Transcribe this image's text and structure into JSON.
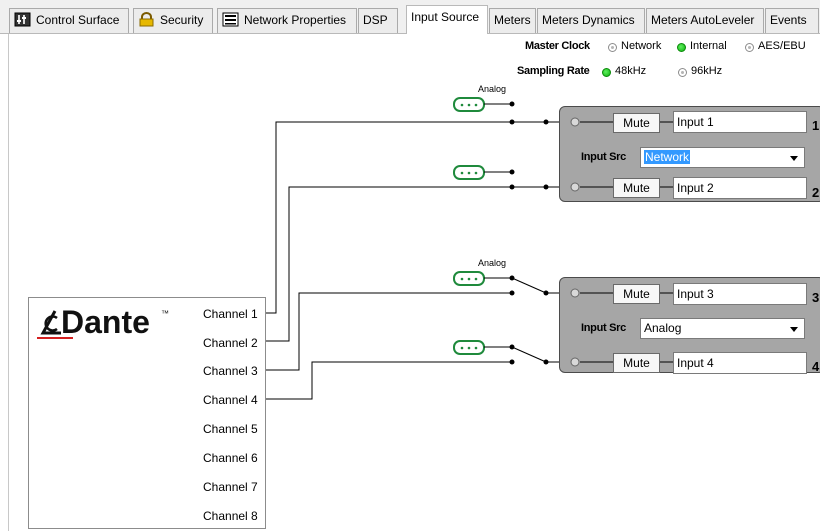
{
  "tabs": [
    {
      "label": "Control Surface",
      "icon": "control-surface-icon",
      "active": false
    },
    {
      "label": "Security",
      "icon": "lock-icon",
      "active": false
    },
    {
      "label": "Network Properties",
      "icon": "network-properties-icon",
      "active": false
    },
    {
      "label": "DSP",
      "icon": "",
      "active": false
    },
    {
      "label": "Input Source",
      "icon": "",
      "active": true
    },
    {
      "label": "Meters",
      "icon": "",
      "active": false
    },
    {
      "label": "Meters Dynamics",
      "icon": "",
      "active": false
    },
    {
      "label": "Meters AutoLeveler",
      "icon": "",
      "active": false
    },
    {
      "label": "Events",
      "icon": "",
      "active": false
    }
  ],
  "master_clock": {
    "label": "Master Clock",
    "options": [
      {
        "label": "Network",
        "selected": false
      },
      {
        "label": "Internal",
        "selected": true
      },
      {
        "label": "AES/EBU",
        "selected": false
      }
    ]
  },
  "sampling_rate": {
    "label": "Sampling Rate",
    "options": [
      {
        "label": "48kHz",
        "selected": true
      },
      {
        "label": "96kHz",
        "selected": false
      }
    ]
  },
  "dante": {
    "logo_text": "Dante",
    "trademark": "™",
    "channels": [
      "Channel 1",
      "Channel 2",
      "Channel 3",
      "Channel 4",
      "Channel 5",
      "Channel 6",
      "Channel 7",
      "Channel 8"
    ]
  },
  "connector_label": "Analog",
  "input_groups": [
    {
      "source_label": "Input Src",
      "source_value": "Network",
      "inputs": [
        {
          "mute_label": "Mute",
          "name": "Input 1",
          "number": "1"
        },
        {
          "mute_label": "Mute",
          "name": "Input 2",
          "number": "2"
        }
      ]
    },
    {
      "source_label": "Input Src",
      "source_value": "Analog",
      "inputs": [
        {
          "mute_label": "Mute",
          "name": "Input 3",
          "number": "3"
        },
        {
          "mute_label": "Mute",
          "name": "Input 4",
          "number": "4"
        }
      ]
    }
  ],
  "colors": {
    "radio_selected": "#1ec81e",
    "box_fill": "#a6a6a6",
    "selection_highlight": "#3399ff",
    "connector_green": "#1f8a3c"
  }
}
